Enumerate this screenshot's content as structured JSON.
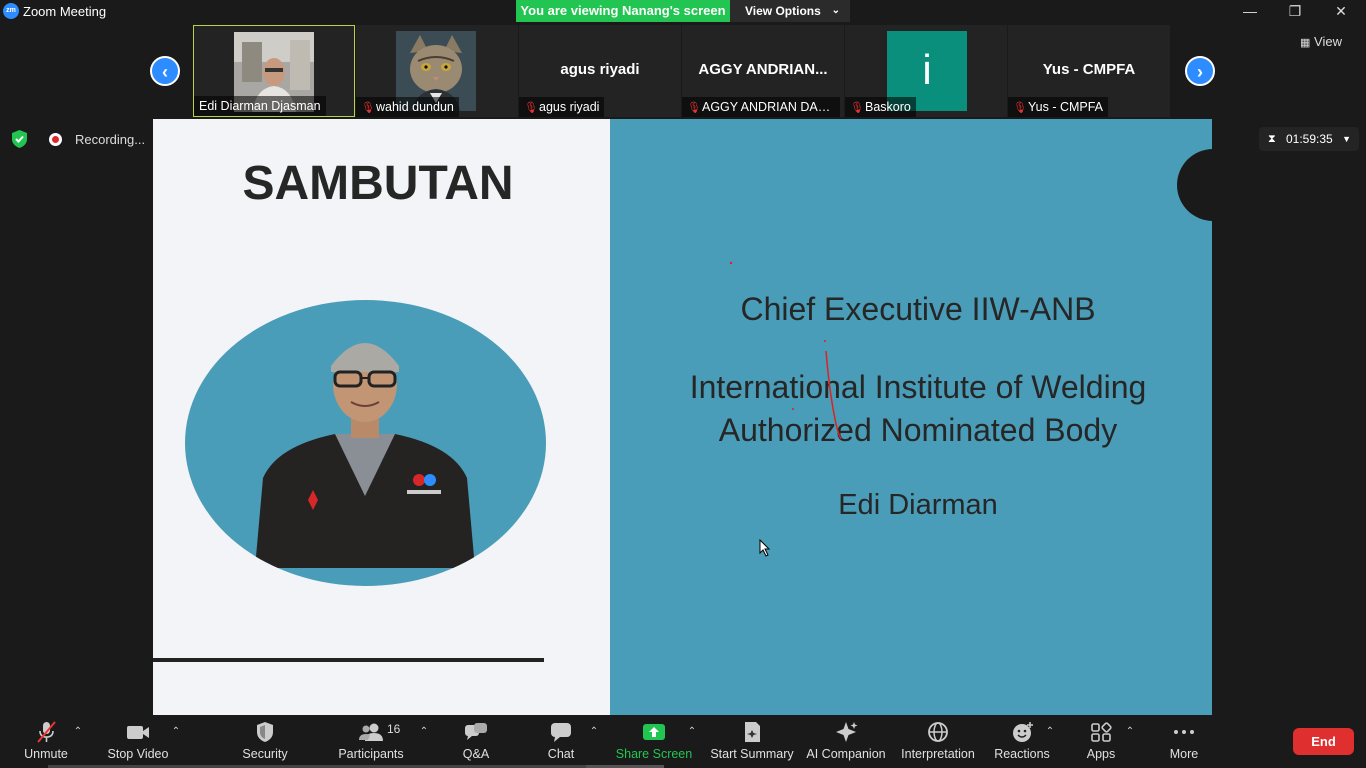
{
  "window": {
    "app_logo": "zm",
    "title": "Zoom Meeting",
    "viewing_banner": "You are viewing Nanang's screen",
    "view_options": "View Options",
    "view_label": "View",
    "minimize": "—",
    "restore": "❐",
    "close": "✕"
  },
  "gallery": {
    "tiles": [
      {
        "caption": "Edi Diarman Djasman",
        "muted": false,
        "active": true,
        "type": "video"
      },
      {
        "caption": "wahid dundun",
        "muted": true,
        "type": "avatar-cat"
      },
      {
        "big_name": "agus riyadi",
        "caption": "agus riyadi",
        "muted": true
      },
      {
        "big_name": "AGGY ANDRIAN...",
        "caption": "AGGY ANDRIAN DAH...",
        "muted": true
      },
      {
        "big_letter": "i",
        "caption": "Baskoro",
        "muted": true,
        "color": "#0a8f7c"
      },
      {
        "big_name": "Yus - CMPFA",
        "caption": "Yus - CMPFA",
        "muted": true
      }
    ]
  },
  "recording": {
    "label": "Recording...",
    "pause_glyph": "❚❚"
  },
  "timer": {
    "value": "01:59:35",
    "icon": "hourglass-icon"
  },
  "slide": {
    "heading": "SAMBUTAN",
    "line1": "Chief Executive IIW-ANB",
    "line2": "International Institute of Welding",
    "line3": "Authorized Nominated Body",
    "name": "Edi Diarman",
    "accent_color": "#4a9db8"
  },
  "toolbar": {
    "unmute": "Unmute",
    "stop_video": "Stop Video",
    "security": "Security",
    "participants": "Participants",
    "participants_count": "16",
    "qa": "Q&A",
    "chat": "Chat",
    "share_screen": "Share Screen",
    "start_summary": "Start Summary",
    "ai_companion": "AI Companion",
    "interpretation": "Interpretation",
    "reactions": "Reactions",
    "apps": "Apps",
    "more": "More",
    "end": "End",
    "share_color": "#23c552",
    "end_color": "#e02f2f"
  }
}
